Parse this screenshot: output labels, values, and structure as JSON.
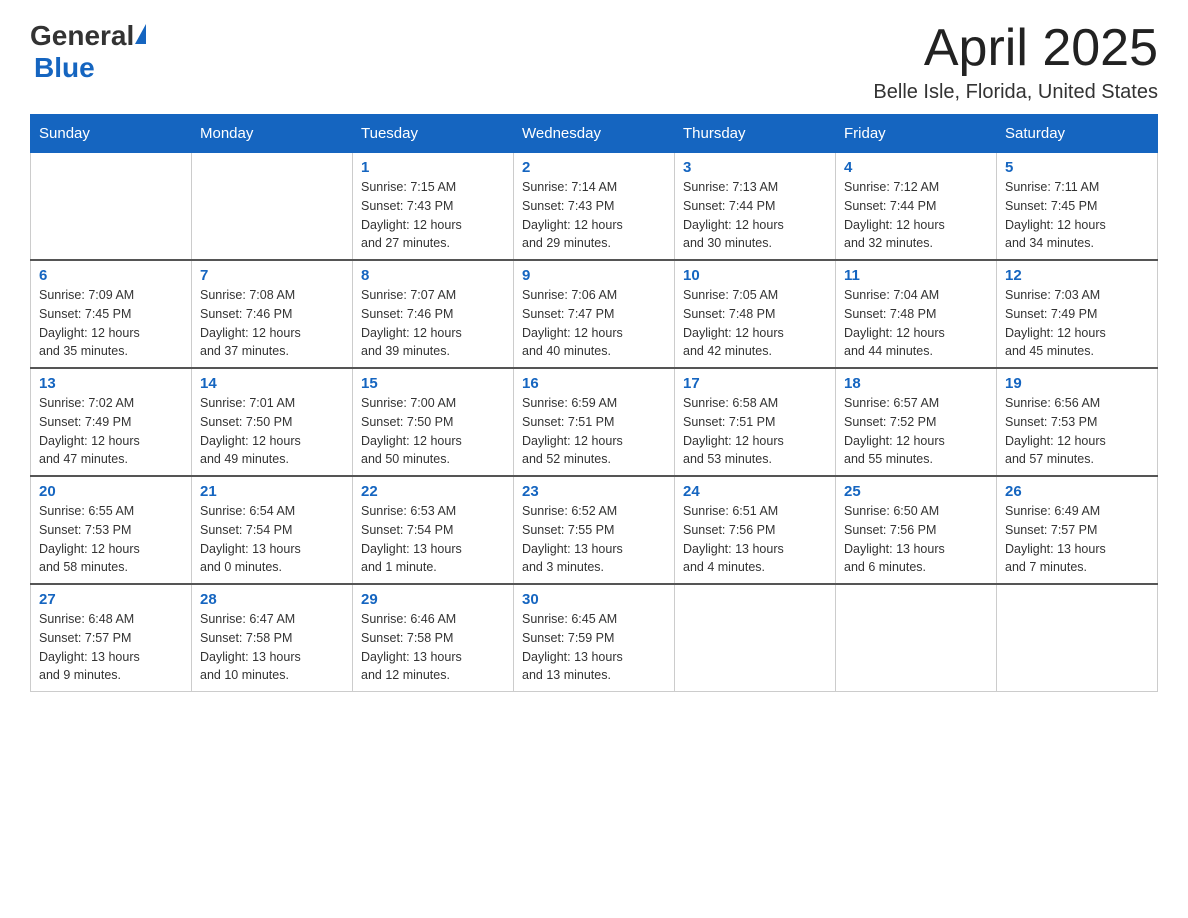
{
  "header": {
    "logo_general": "General",
    "logo_blue": "Blue",
    "title": "April 2025",
    "subtitle": "Belle Isle, Florida, United States"
  },
  "days_of_week": [
    "Sunday",
    "Monday",
    "Tuesday",
    "Wednesday",
    "Thursday",
    "Friday",
    "Saturday"
  ],
  "weeks": [
    [
      {
        "day": "",
        "info": ""
      },
      {
        "day": "",
        "info": ""
      },
      {
        "day": "1",
        "info": "Sunrise: 7:15 AM\nSunset: 7:43 PM\nDaylight: 12 hours\nand 27 minutes."
      },
      {
        "day": "2",
        "info": "Sunrise: 7:14 AM\nSunset: 7:43 PM\nDaylight: 12 hours\nand 29 minutes."
      },
      {
        "day": "3",
        "info": "Sunrise: 7:13 AM\nSunset: 7:44 PM\nDaylight: 12 hours\nand 30 minutes."
      },
      {
        "day": "4",
        "info": "Sunrise: 7:12 AM\nSunset: 7:44 PM\nDaylight: 12 hours\nand 32 minutes."
      },
      {
        "day": "5",
        "info": "Sunrise: 7:11 AM\nSunset: 7:45 PM\nDaylight: 12 hours\nand 34 minutes."
      }
    ],
    [
      {
        "day": "6",
        "info": "Sunrise: 7:09 AM\nSunset: 7:45 PM\nDaylight: 12 hours\nand 35 minutes."
      },
      {
        "day": "7",
        "info": "Sunrise: 7:08 AM\nSunset: 7:46 PM\nDaylight: 12 hours\nand 37 minutes."
      },
      {
        "day": "8",
        "info": "Sunrise: 7:07 AM\nSunset: 7:46 PM\nDaylight: 12 hours\nand 39 minutes."
      },
      {
        "day": "9",
        "info": "Sunrise: 7:06 AM\nSunset: 7:47 PM\nDaylight: 12 hours\nand 40 minutes."
      },
      {
        "day": "10",
        "info": "Sunrise: 7:05 AM\nSunset: 7:48 PM\nDaylight: 12 hours\nand 42 minutes."
      },
      {
        "day": "11",
        "info": "Sunrise: 7:04 AM\nSunset: 7:48 PM\nDaylight: 12 hours\nand 44 minutes."
      },
      {
        "day": "12",
        "info": "Sunrise: 7:03 AM\nSunset: 7:49 PM\nDaylight: 12 hours\nand 45 minutes."
      }
    ],
    [
      {
        "day": "13",
        "info": "Sunrise: 7:02 AM\nSunset: 7:49 PM\nDaylight: 12 hours\nand 47 minutes."
      },
      {
        "day": "14",
        "info": "Sunrise: 7:01 AM\nSunset: 7:50 PM\nDaylight: 12 hours\nand 49 minutes."
      },
      {
        "day": "15",
        "info": "Sunrise: 7:00 AM\nSunset: 7:50 PM\nDaylight: 12 hours\nand 50 minutes."
      },
      {
        "day": "16",
        "info": "Sunrise: 6:59 AM\nSunset: 7:51 PM\nDaylight: 12 hours\nand 52 minutes."
      },
      {
        "day": "17",
        "info": "Sunrise: 6:58 AM\nSunset: 7:51 PM\nDaylight: 12 hours\nand 53 minutes."
      },
      {
        "day": "18",
        "info": "Sunrise: 6:57 AM\nSunset: 7:52 PM\nDaylight: 12 hours\nand 55 minutes."
      },
      {
        "day": "19",
        "info": "Sunrise: 6:56 AM\nSunset: 7:53 PM\nDaylight: 12 hours\nand 57 minutes."
      }
    ],
    [
      {
        "day": "20",
        "info": "Sunrise: 6:55 AM\nSunset: 7:53 PM\nDaylight: 12 hours\nand 58 minutes."
      },
      {
        "day": "21",
        "info": "Sunrise: 6:54 AM\nSunset: 7:54 PM\nDaylight: 13 hours\nand 0 minutes."
      },
      {
        "day": "22",
        "info": "Sunrise: 6:53 AM\nSunset: 7:54 PM\nDaylight: 13 hours\nand 1 minute."
      },
      {
        "day": "23",
        "info": "Sunrise: 6:52 AM\nSunset: 7:55 PM\nDaylight: 13 hours\nand 3 minutes."
      },
      {
        "day": "24",
        "info": "Sunrise: 6:51 AM\nSunset: 7:56 PM\nDaylight: 13 hours\nand 4 minutes."
      },
      {
        "day": "25",
        "info": "Sunrise: 6:50 AM\nSunset: 7:56 PM\nDaylight: 13 hours\nand 6 minutes."
      },
      {
        "day": "26",
        "info": "Sunrise: 6:49 AM\nSunset: 7:57 PM\nDaylight: 13 hours\nand 7 minutes."
      }
    ],
    [
      {
        "day": "27",
        "info": "Sunrise: 6:48 AM\nSunset: 7:57 PM\nDaylight: 13 hours\nand 9 minutes."
      },
      {
        "day": "28",
        "info": "Sunrise: 6:47 AM\nSunset: 7:58 PM\nDaylight: 13 hours\nand 10 minutes."
      },
      {
        "day": "29",
        "info": "Sunrise: 6:46 AM\nSunset: 7:58 PM\nDaylight: 13 hours\nand 12 minutes."
      },
      {
        "day": "30",
        "info": "Sunrise: 6:45 AM\nSunset: 7:59 PM\nDaylight: 13 hours\nand 13 minutes."
      },
      {
        "day": "",
        "info": ""
      },
      {
        "day": "",
        "info": ""
      },
      {
        "day": "",
        "info": ""
      }
    ]
  ]
}
